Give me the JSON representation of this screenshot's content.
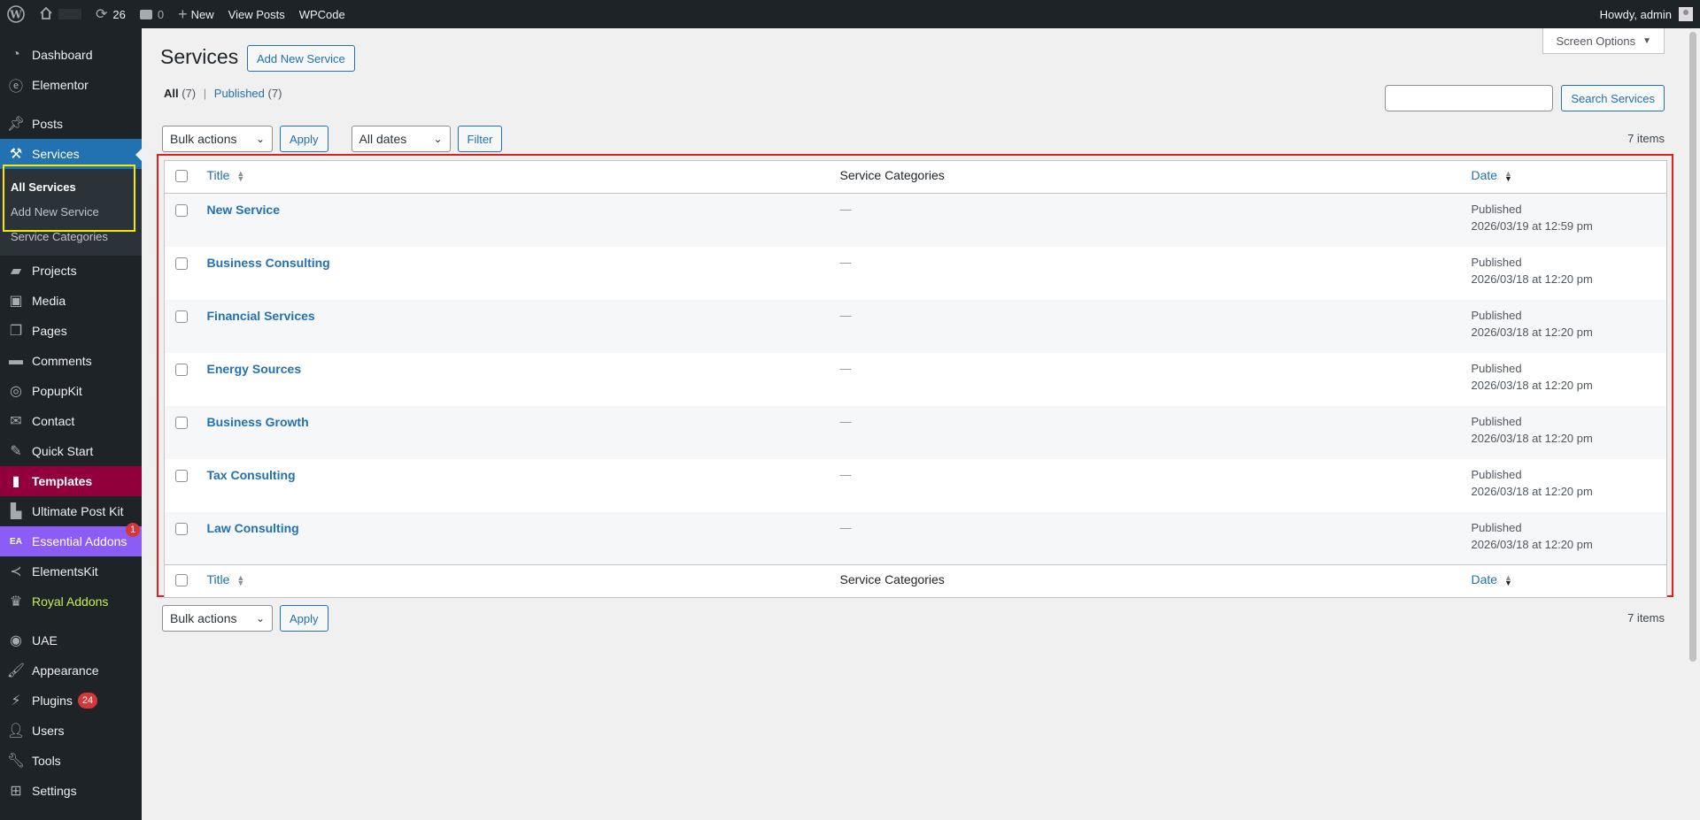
{
  "adminbar": {
    "updates_count": "26",
    "comments_count": "0",
    "new_label": "New",
    "view_posts": "View Posts",
    "wpcode": "WPCode",
    "howdy": "Howdy, admin"
  },
  "sidebar": {
    "dashboard": "Dashboard",
    "elementor": "Elementor",
    "posts": "Posts",
    "services": "Services",
    "services_sub": {
      "all": "All Services",
      "add_new": "Add New Service",
      "categories": "Service Categories"
    },
    "projects": "Projects",
    "media": "Media",
    "pages": "Pages",
    "comments": "Comments",
    "popupkit": "PopupKit",
    "contact": "Contact",
    "quick_start": "Quick Start",
    "templates": "Templates",
    "ultimate_post_kit": "Ultimate Post Kit",
    "essential_addons": "Essential Addons",
    "essential_addons_badge": "1",
    "elementskit": "ElementsKit",
    "royal_addons": "Royal Addons",
    "uae": "UAE",
    "appearance": "Appearance",
    "plugins": "Plugins",
    "plugins_badge": "24",
    "users": "Users",
    "tools": "Tools",
    "settings": "Settings"
  },
  "page": {
    "title": "Services",
    "add_new": "Add New Service",
    "screen_options": "Screen Options",
    "filters": {
      "all": "All",
      "all_count": "(7)",
      "separator": "|",
      "published": "Published",
      "published_count": "(7)"
    },
    "search_button": "Search Services",
    "bulk_actions": "Bulk actions",
    "apply": "Apply",
    "all_dates": "All dates",
    "filter": "Filter",
    "items_count": "7 items"
  },
  "table": {
    "columns": {
      "title": "Title",
      "categories": "Service Categories",
      "date": "Date"
    },
    "rows": [
      {
        "title": "New Service",
        "category": "—",
        "status": "Published",
        "date": "2026/03/19 at 12:59 pm"
      },
      {
        "title": "Business Consulting",
        "category": "—",
        "status": "Published",
        "date": "2026/03/18 at 12:20 pm"
      },
      {
        "title": "Financial Services",
        "category": "—",
        "status": "Published",
        "date": "2026/03/18 at 12:20 pm"
      },
      {
        "title": "Energy Sources",
        "category": "—",
        "status": "Published",
        "date": "2026/03/18 at 12:20 pm"
      },
      {
        "title": "Business Growth",
        "category": "—",
        "status": "Published",
        "date": "2026/03/18 at 12:20 pm"
      },
      {
        "title": "Tax Consulting",
        "category": "—",
        "status": "Published",
        "date": "2026/03/18 at 12:20 pm"
      },
      {
        "title": "Law Consulting",
        "category": "—",
        "status": "Published",
        "date": "2026/03/18 at 12:20 pm"
      }
    ]
  },
  "colors": {
    "accent": "#2271b1",
    "adminbar_bg": "#1d2327",
    "highlight_red": "#e0201f",
    "highlight_yellow": "#f5e900",
    "templates_bg": "#92003b",
    "essential_addons_bg": "#8b5cf6"
  }
}
